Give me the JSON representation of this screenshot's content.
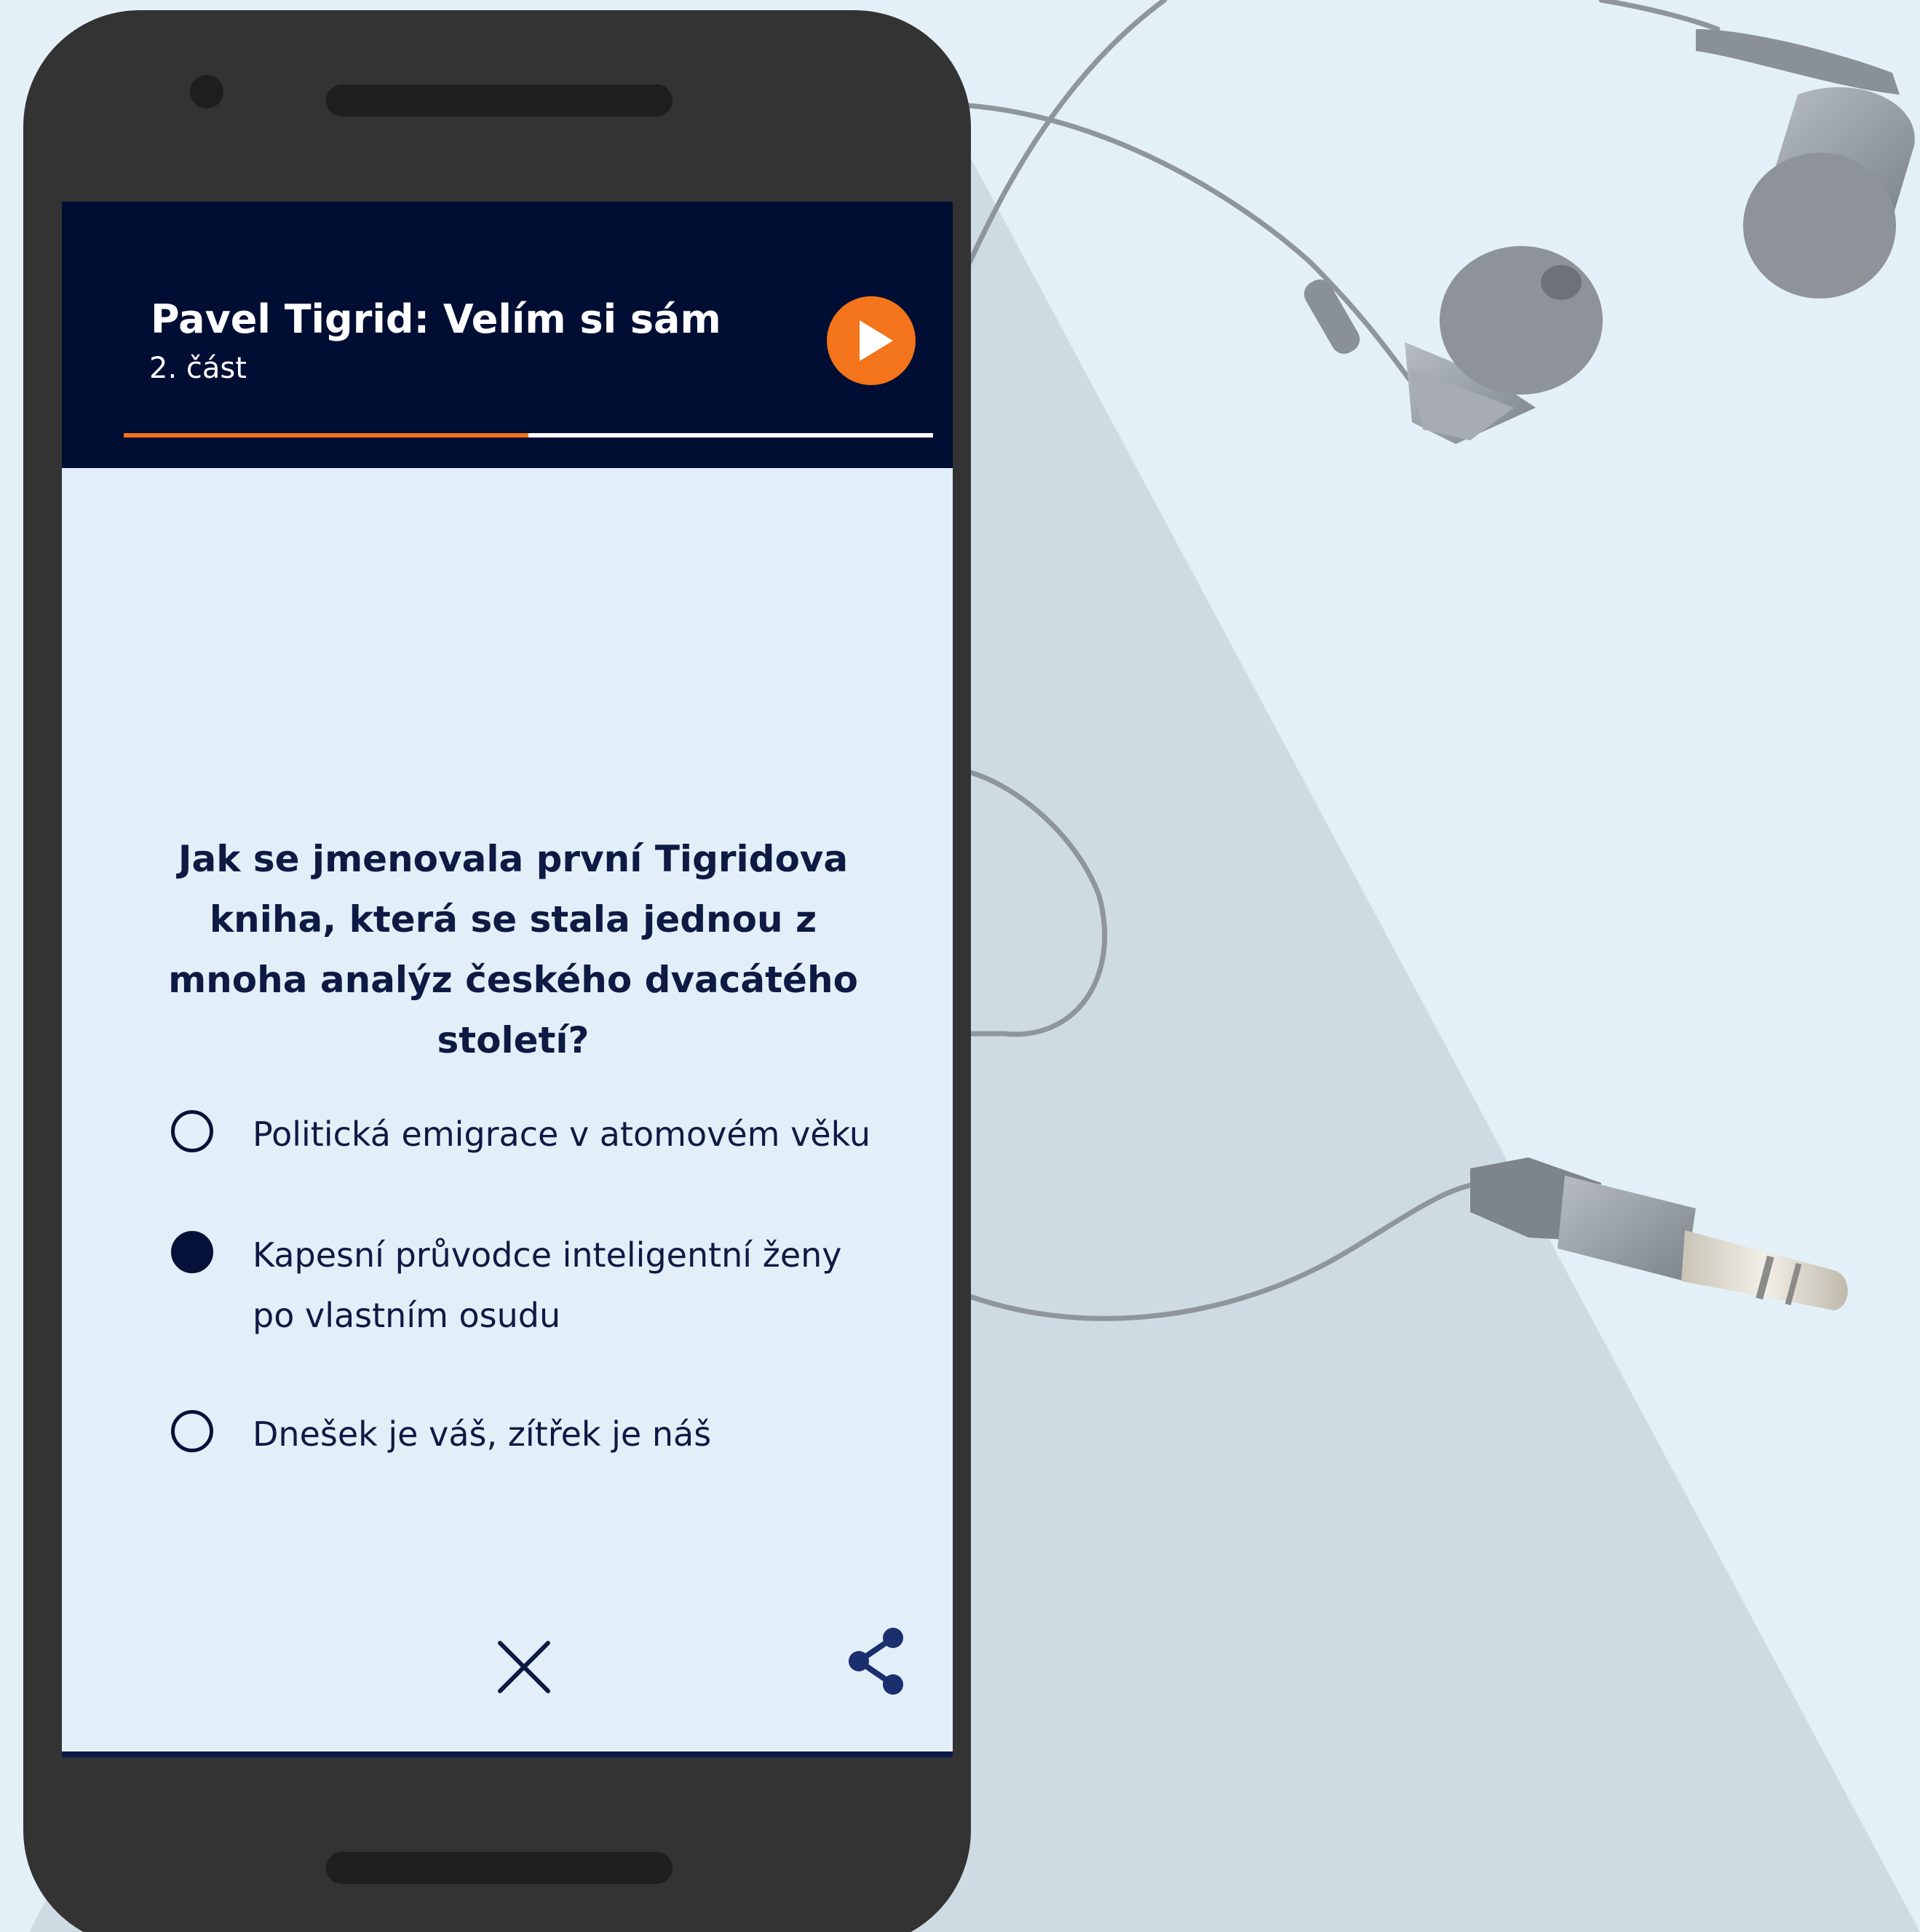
{
  "app": {
    "episode_title": "Pavel Tigrid: Velím si sám",
    "episode_part": "2. část"
  },
  "player": {
    "play_icon": "play-icon",
    "progress": 0.5,
    "colors": {
      "accent": "#f3741a",
      "header_bg": "#000e33",
      "text": "#0d1a44"
    }
  },
  "quiz": {
    "question": "Jak se jmenovala první Tigridova kniha, která se stala jednou z mnoha analýz českého dvacátého století?",
    "options": [
      {
        "label": "Politická emigrace v atomovém věku",
        "selected": false
      },
      {
        "label": "Kapesní průvodce inteligentní ženy po vlastním osudu",
        "selected": true
      },
      {
        "label": "Dnešek je váš, zítřek je náš",
        "selected": false
      }
    ]
  },
  "footer": {
    "close_icon": "close-icon",
    "share_icon": "share-icon"
  }
}
